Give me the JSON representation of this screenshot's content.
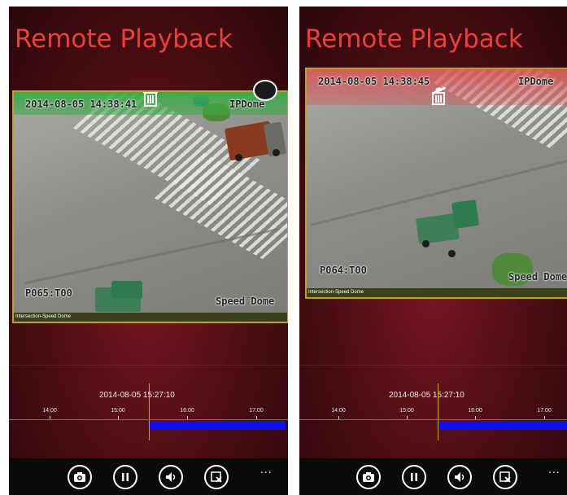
{
  "phones": [
    {
      "app_title": "Remote Playback",
      "video": {
        "timestamp": "2014-08-05 14:38:41",
        "camera_type": "IPDome",
        "preset": "P065:T00",
        "model": "Speed Dome",
        "caption": "Intersection-Speed Dome",
        "drop_zone_state": "delete-ready"
      },
      "timeline": {
        "current_time_label": "2014-08-05 15:27:10",
        "ticks": [
          "14:00",
          "15:00",
          "16:00",
          "17:00"
        ]
      }
    },
    {
      "app_title": "Remote Playback",
      "video": {
        "timestamp": "2014-08-05 14:38:45",
        "camera_type": "IPDome",
        "preset": "P064:T00",
        "model": "Speed Dome",
        "caption": "Intersection-Speed Dome",
        "drop_zone_state": "deleting"
      },
      "timeline": {
        "current_time_label": "2014-08-05 15:27:10",
        "ticks": [
          "14:00",
          "15:00",
          "16:00",
          "17:00"
        ]
      }
    }
  ],
  "appbar": {
    "buttons": [
      "camera-icon",
      "pause-icon",
      "volume-icon",
      "close-window-icon"
    ],
    "more": "..."
  },
  "colors": {
    "title": "#e8413a",
    "record_bar": "#1010ee",
    "cursor": "#c8a326",
    "delete_green": "#3caa46",
    "delete_red": "#dc5050"
  }
}
